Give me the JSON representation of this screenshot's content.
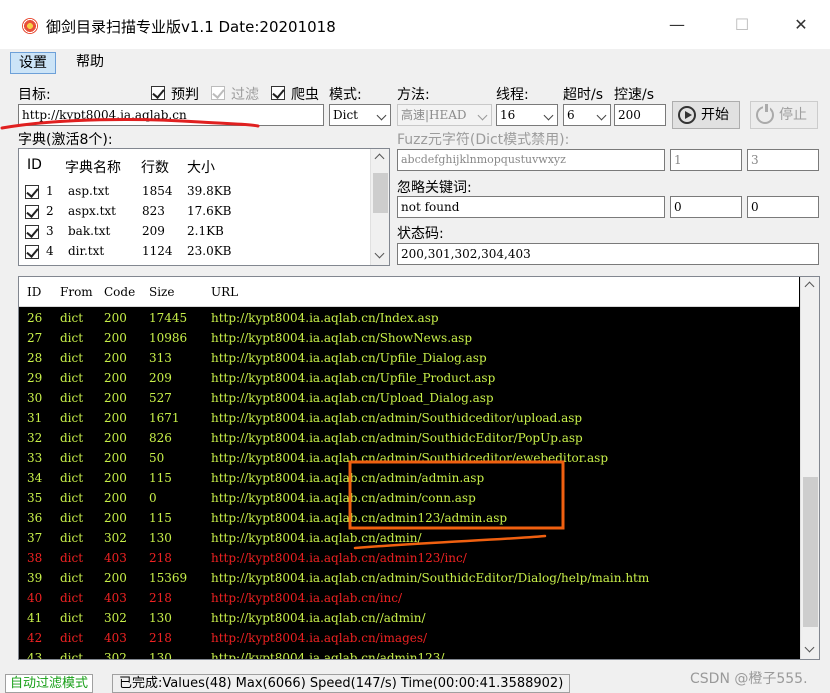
{
  "window": {
    "title": "御剑目录扫描专业版v1.1 Date:20201018",
    "minimize": "—",
    "maximize": "☐",
    "close": "✕"
  },
  "menu": {
    "items": [
      "设置",
      "帮助"
    ]
  },
  "target": {
    "label": "目标:",
    "value": "http://kypt8004.ia.aqlab.cn"
  },
  "options": {
    "prejudge": {
      "label": "预判",
      "checked": true
    },
    "filter": {
      "label": "过滤",
      "checked": true,
      "disabled": true
    },
    "crawler": {
      "label": "爬虫",
      "checked": true
    }
  },
  "mode": {
    "label": "模式:",
    "value": "Dict"
  },
  "method": {
    "label": "方法:",
    "value": "高速|HEAD"
  },
  "threads": {
    "label": "线程:",
    "value": "16"
  },
  "timeout": {
    "label": "超时/s",
    "value": "6"
  },
  "throttle": {
    "label": "控速/s",
    "value": "200"
  },
  "buttons": {
    "start": "开始",
    "stop": "停止"
  },
  "dict": {
    "label": "字典(激活8个):",
    "headers": [
      "ID",
      "字典名称",
      "行数",
      "大小"
    ],
    "rows": [
      {
        "id": "1",
        "name": "asp.txt",
        "lines": "1854",
        "size": "39.8KB"
      },
      {
        "id": "2",
        "name": "aspx.txt",
        "lines": "823",
        "size": "17.6KB"
      },
      {
        "id": "3",
        "name": "bak.txt",
        "lines": "209",
        "size": "2.1KB"
      },
      {
        "id": "4",
        "name": "dir.txt",
        "lines": "1124",
        "size": "23.0KB"
      }
    ]
  },
  "fuzz": {
    "label": "Fuzz元字符(Dict模式禁用):",
    "chars": "abcdefghijklnmopqustuvwxyz",
    "min": "1",
    "max": "3"
  },
  "ignore": {
    "label": "忽略关键词:",
    "value": "not found",
    "a": "0",
    "b": "0"
  },
  "status_codes": {
    "label": "状态码:",
    "value": "200,301,302,304,403"
  },
  "results": {
    "headers": [
      "ID",
      "From",
      "Code",
      "Size",
      "URL"
    ],
    "rows": [
      {
        "id": "26",
        "from": "dict",
        "code": "200",
        "size": "17445",
        "url": "http://kypt8004.ia.aqlab.cn/Index.asp"
      },
      {
        "id": "27",
        "from": "dict",
        "code": "200",
        "size": "10986",
        "url": "http://kypt8004.ia.aqlab.cn/ShowNews.asp"
      },
      {
        "id": "28",
        "from": "dict",
        "code": "200",
        "size": "313",
        "url": "http://kypt8004.ia.aqlab.cn/Upfile_Dialog.asp"
      },
      {
        "id": "29",
        "from": "dict",
        "code": "200",
        "size": "209",
        "url": "http://kypt8004.ia.aqlab.cn/Upfile_Product.asp"
      },
      {
        "id": "30",
        "from": "dict",
        "code": "200",
        "size": "527",
        "url": "http://kypt8004.ia.aqlab.cn/Upload_Dialog.asp"
      },
      {
        "id": "31",
        "from": "dict",
        "code": "200",
        "size": "1671",
        "url": "http://kypt8004.ia.aqlab.cn/admin/Southidceditor/upload.asp"
      },
      {
        "id": "32",
        "from": "dict",
        "code": "200",
        "size": "826",
        "url": "http://kypt8004.ia.aqlab.cn/admin/SouthidcEditor/PopUp.asp"
      },
      {
        "id": "33",
        "from": "dict",
        "code": "200",
        "size": "50",
        "url": "http://kypt8004.ia.aqlab.cn/admin/Southidceditor/ewebeditor.asp"
      },
      {
        "id": "34",
        "from": "dict",
        "code": "200",
        "size": "115",
        "url": "http://kypt8004.ia.aqlab.cn/admin/admin.asp"
      },
      {
        "id": "35",
        "from": "dict",
        "code": "200",
        "size": "0",
        "url": "http://kypt8004.ia.aqlab.cn/admin/conn.asp"
      },
      {
        "id": "36",
        "from": "dict",
        "code": "200",
        "size": "115",
        "url": "http://kypt8004.ia.aqlab.cn/admin123/admin.asp"
      },
      {
        "id": "37",
        "from": "dict",
        "code": "302",
        "size": "130",
        "url": "http://kypt8004.ia.aqlab.cn/admin/"
      },
      {
        "id": "38",
        "from": "dict",
        "code": "403",
        "size": "218",
        "url": "http://kypt8004.ia.aqlab.cn/admin123/inc/",
        "color": "#ee2222"
      },
      {
        "id": "39",
        "from": "dict",
        "code": "200",
        "size": "15369",
        "url": "http://kypt8004.ia.aqlab.cn/admin/SouthidcEditor/Dialog/help/main.htm"
      },
      {
        "id": "40",
        "from": "dict",
        "code": "403",
        "size": "218",
        "url": "http://kypt8004.ia.aqlab.cn/inc/",
        "color": "#ee2222"
      },
      {
        "id": "41",
        "from": "dict",
        "code": "302",
        "size": "130",
        "url": "http://kypt8004.ia.aqlab.cn//admin/"
      },
      {
        "id": "42",
        "from": "dict",
        "code": "403",
        "size": "218",
        "url": "http://kypt8004.ia.aqlab.cn/images/",
        "color": "#ee2222"
      },
      {
        "id": "43",
        "from": "dict",
        "code": "302",
        "size": "130",
        "url": "http://kypt8004.ia.aqlab.cn/admin123/"
      }
    ]
  },
  "status": {
    "mode": "自动过滤模式",
    "text": "已完成:Values(48) Max(6066) Speed(147/s) Time(00:00:41.3588902)"
  },
  "watermark": "CSDN @橙子555.",
  "colors": {
    "result_green": "#c8f04a",
    "result_red": "#ee2222",
    "annotation_red": "#e02020",
    "annotation_orange": "#f06010"
  }
}
